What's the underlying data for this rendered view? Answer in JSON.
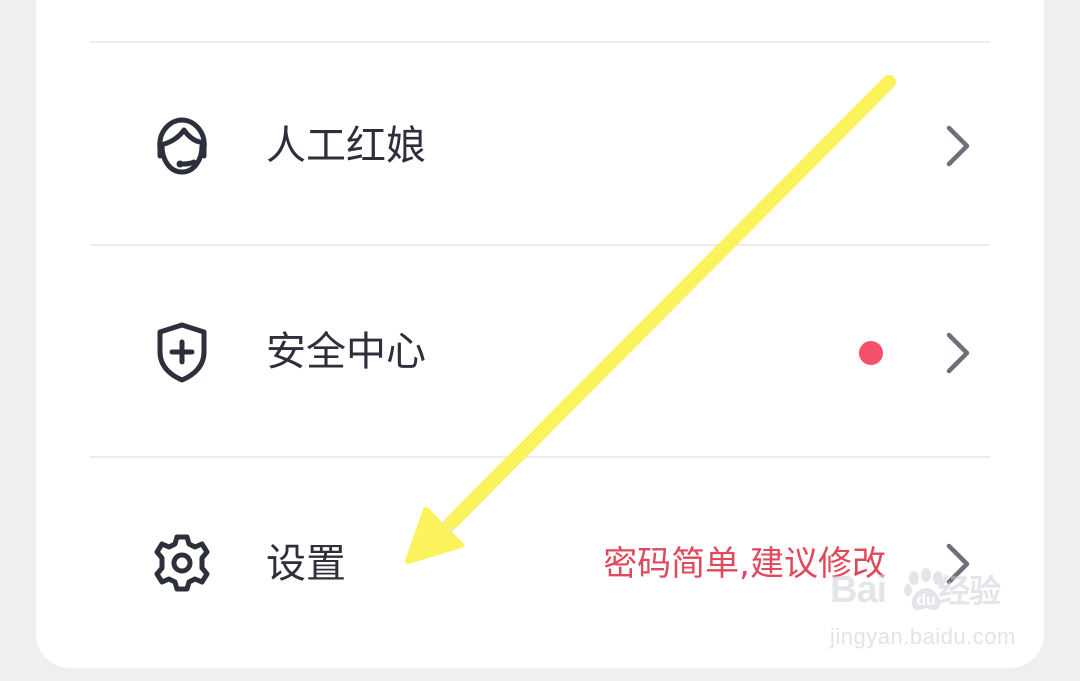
{
  "menu": {
    "items": [
      {
        "label": "人工红娘",
        "icon": "customer-service-icon"
      },
      {
        "label": "安全中心",
        "icon": "shield-plus-icon",
        "badge": "red-dot"
      },
      {
        "label": "设置",
        "icon": "gear-icon",
        "hint": "密码简单,建议修改"
      }
    ]
  },
  "colors": {
    "background": "#efeff1",
    "card": "#ffffff",
    "divider": "#ececee",
    "label_text": "#2d2f3b",
    "chevron": "#6e6f7a",
    "badge_red": "#f5506a",
    "hint_red": "#e0485c",
    "annotation_arrow": "#faf35c"
  },
  "annotation": {
    "icon": "yellow-arrow-pointing-to-settings"
  },
  "watermark": {
    "brand": "Bai",
    "brand_tail": "经验",
    "subtitle": "jingyan.baidu.com"
  }
}
